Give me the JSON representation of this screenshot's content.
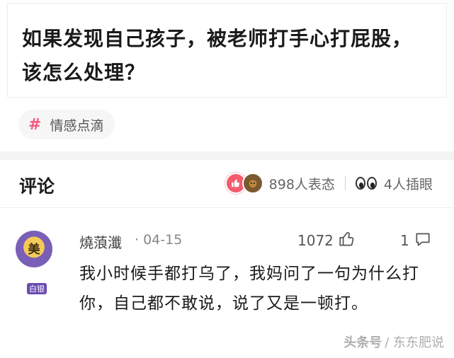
{
  "article": {
    "title": "如果发现自己孩子，被老师打手心打屁股，该怎么处理？",
    "tag_icon": "hash-icon",
    "tag_label": "情感点滴"
  },
  "comments_header": {
    "title": "评论",
    "reaction_summary": "898人表态",
    "peek_summary": "4人插眼"
  },
  "comment": {
    "avatar_text": "美",
    "avatar_badge": "白银",
    "username": "燒蒗瀸",
    "date": "· 04-15",
    "likes": "1072",
    "replies": "1",
    "body": "我小时候手都打乌了，我妈问了一句为什么打你，自己都不敢说，说了又是一顿打。"
  },
  "watermark": {
    "logo": "头条号",
    "text": "/ 东东肥说"
  },
  "colors": {
    "accent_pink": "#f2597f",
    "like_red": "#f45b6d",
    "avatar_purple": "#7a5fb7"
  }
}
